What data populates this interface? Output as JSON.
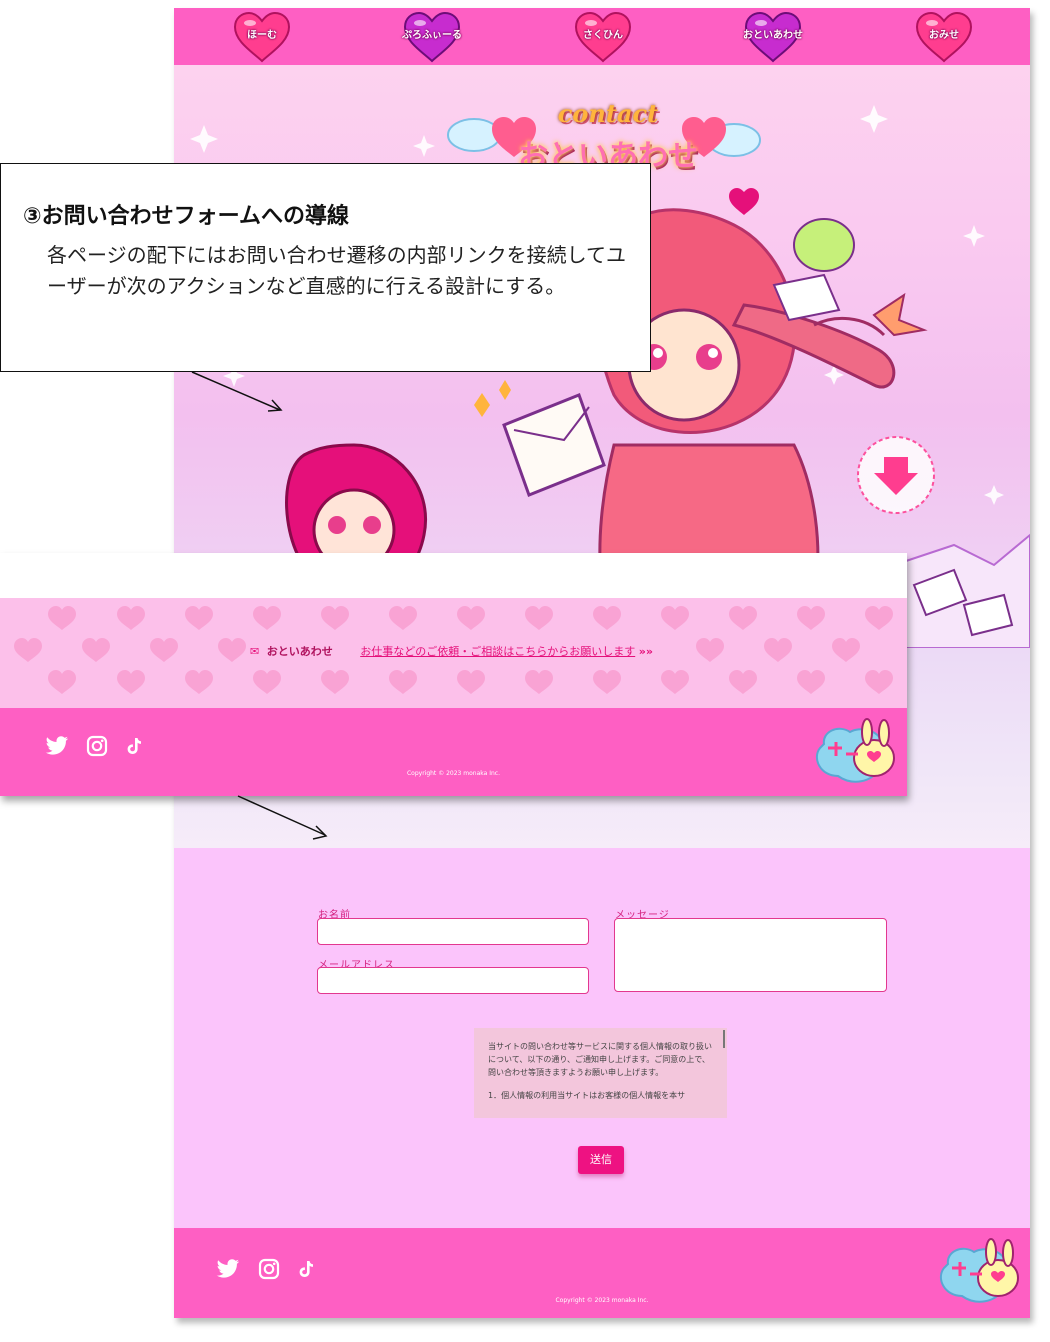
{
  "nav": {
    "items": [
      {
        "label": "ほーむ",
        "color": "#ff3d8f"
      },
      {
        "label": "ぷろふぃーる",
        "color": "#c72ccf"
      },
      {
        "label": "さくひん",
        "color": "#ff3d8f"
      },
      {
        "label": "おといあわせ",
        "color": "#c72ccf"
      },
      {
        "label": "おみせ",
        "color": "#ff3d8f"
      }
    ]
  },
  "hero": {
    "title_en": "contact",
    "title_jp": "おといあわせ"
  },
  "annotation": {
    "title": "③お問い合わせフォームへの導線",
    "body": "各ページの配下にはお問い合わせ遷移の内部リンクを接続してユーザーが次のアクションなど直感的に行える設計にする。"
  },
  "overlay": {
    "contact_label": "おといあわせ",
    "contact_link": "お仕事などのご依頼・ご相談はこちらからお願いします",
    "copyright": "Copyright © 2023 monaka Inc."
  },
  "form": {
    "name_label": "お名前",
    "email_label": "メールアドレス",
    "message_label": "メッセージ",
    "name_value": "",
    "email_value": "",
    "message_value": "",
    "policy_line1": "当サイトの問い合わせ等サービスに関する個人情報の取り扱いについて、以下の通り、ご通知申し上げます。ご同意の上で、問い合わせ等頂きますようお願い申し上げます。",
    "policy_line2": "1．個人情報の利用当サイトはお客様の個人情報を本サ",
    "submit_label": "送信"
  },
  "footer": {
    "copyright": "Copyright © 2023 monaka Inc."
  },
  "colors": {
    "accent": "#fe5fc3",
    "form_bg": "#fbc4fb",
    "button": "#ee1282",
    "label": "#d4237f"
  }
}
